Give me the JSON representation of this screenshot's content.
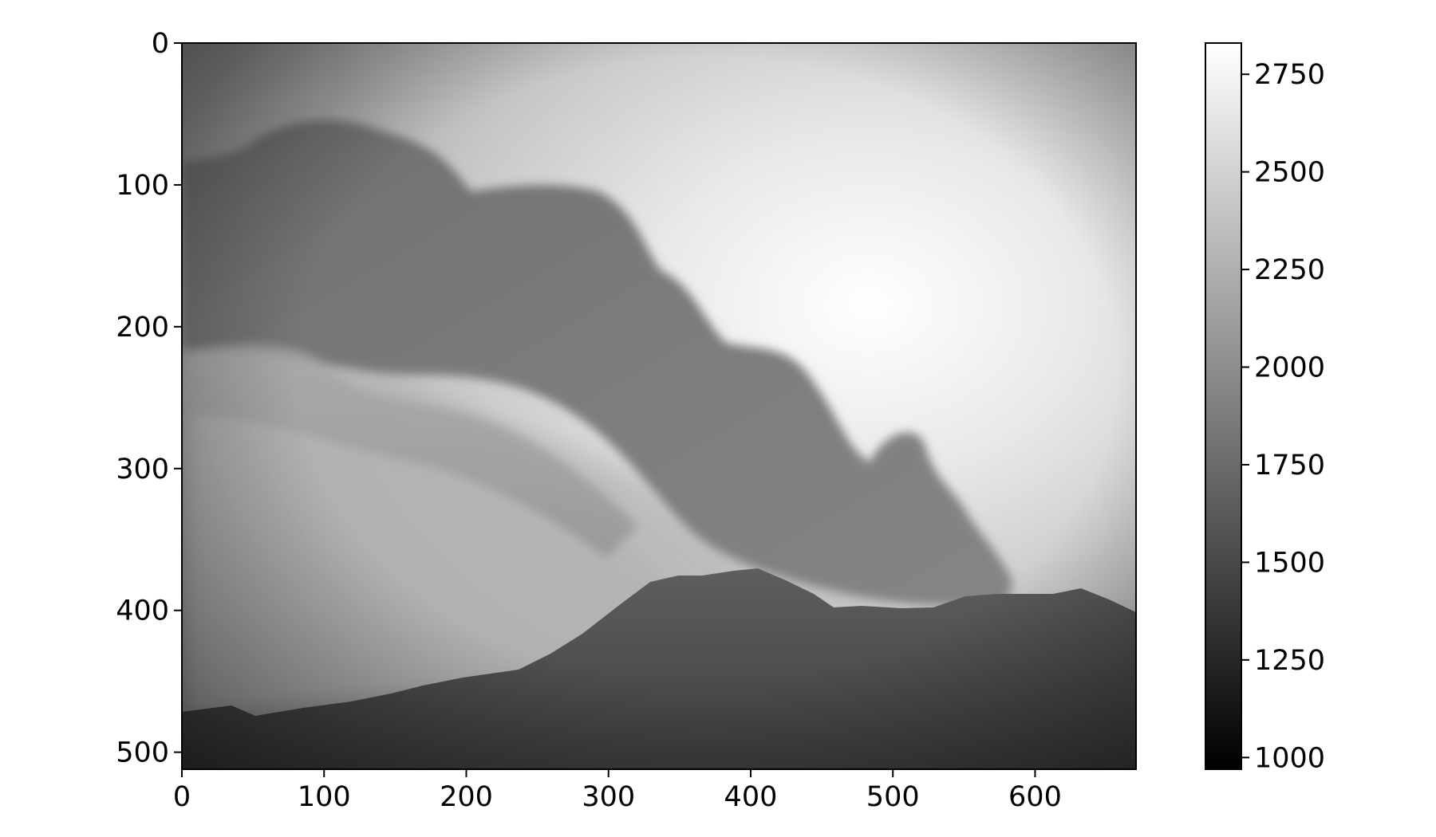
{
  "chart_data": {
    "type": "heatmap",
    "title": "",
    "xlabel": "",
    "ylabel": "",
    "xlim": [
      0,
      671
    ],
    "ylim": [
      512,
      0
    ],
    "y_axis_inverted": true,
    "grid": false,
    "colormap": "gray",
    "x_ticks": [
      "0",
      "100",
      "200",
      "300",
      "400",
      "500",
      "600"
    ],
    "y_ticks": [
      "0",
      "100",
      "200",
      "300",
      "400",
      "500"
    ],
    "colorbar": {
      "range": [
        970,
        2830
      ],
      "ticks": [
        "1000",
        "1250",
        "1500",
        "1750",
        "2000",
        "2250",
        "2500",
        "2750"
      ],
      "placement": "right"
    },
    "approx_values": {
      "sky_bright_center": 2800,
      "sky_upper_left": 2050,
      "plume_upper_left": 1900,
      "plume_diffuse_lower_left": 2200,
      "volcano_body": 1600,
      "ground_lower_corners": 1000
    }
  }
}
